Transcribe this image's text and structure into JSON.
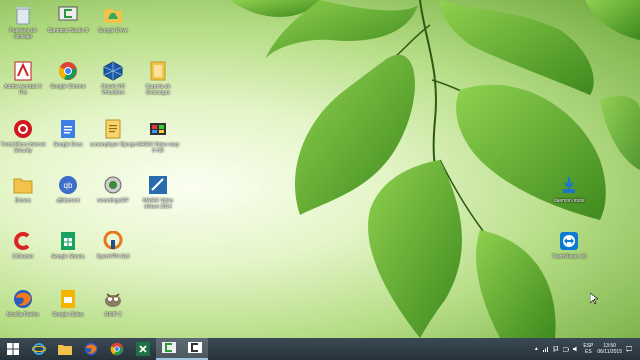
{
  "desktop_icons": [
    {
      "label": "Papelera de reciclaje",
      "icon": "recycle-bin-icon"
    },
    {
      "label": "Camtasia Studio 8",
      "icon": "camtasia-icon"
    },
    {
      "label": "Google Drive",
      "icon": "google-drive-icon"
    },
    {
      "label": "Adobe Acrobat X Pro",
      "icon": "acrobat-icon"
    },
    {
      "label": "Google Chrome",
      "icon": "chrome-icon"
    },
    {
      "label": "Oracle VM VirtualBox",
      "icon": "virtualbox-icon"
    },
    {
      "label": "Carpeta de Descargas",
      "icon": "folder-icon"
    },
    {
      "label": "Trend Micro Internet Security",
      "icon": "trend-micro-icon"
    },
    {
      "label": "Google Docs",
      "icon": "google-docs-icon"
    },
    {
      "label": "screenplayer Django",
      "icon": "document-icon"
    },
    {
      "label": "MAGIX Video easy 5 HD",
      "icon": "magix-icon"
    },
    {
      "label": "Drivers",
      "icon": "folder-icon"
    },
    {
      "label": "qBittorrent",
      "icon": "qbittorrent-icon"
    },
    {
      "label": "recordingsGIF",
      "icon": "recorder-icon"
    },
    {
      "label": "MAGIX Video deluxe 2014",
      "icon": "magix-deluxe-icon"
    },
    {
      "label": "CCleaner",
      "icon": "ccleaner-icon"
    },
    {
      "label": "Google Sheets",
      "icon": "google-sheets-icon"
    },
    {
      "label": "OpenVPN GUI",
      "icon": "openvpn-icon"
    },
    {
      "label": "Mozilla Firefox",
      "icon": "firefox-icon"
    },
    {
      "label": "Google Slides",
      "icon": "google-slides-icon"
    },
    {
      "label": "GIMP 2",
      "icon": "gimp-icon"
    },
    {
      "label": "daemon-tools",
      "icon": "daemon-tools-icon"
    },
    {
      "label": "TeamViewer 10",
      "icon": "teamviewer-icon"
    }
  ],
  "taskbar": {
    "items": [
      {
        "icon": "windows-start-icon"
      },
      {
        "icon": "internet-explorer-icon"
      },
      {
        "icon": "file-explorer-icon"
      },
      {
        "icon": "firefox-icon"
      },
      {
        "icon": "chrome-icon"
      },
      {
        "icon": "excel-icon"
      },
      {
        "icon": "camtasia-recorder-icon"
      },
      {
        "icon": "camtasia-studio-icon"
      }
    ]
  },
  "tray": {
    "language": "ESP",
    "language_sub": "ES",
    "time": "13:50",
    "date": "06/11/2015",
    "icons": [
      "chevron-up-icon",
      "network-icon",
      "flag-icon",
      "battery-icon",
      "volume-icon",
      "message-icon"
    ]
  },
  "colors": {
    "taskbar": "#2e3c45",
    "leaf": "#5fa830",
    "label_text": "#ffffff"
  }
}
